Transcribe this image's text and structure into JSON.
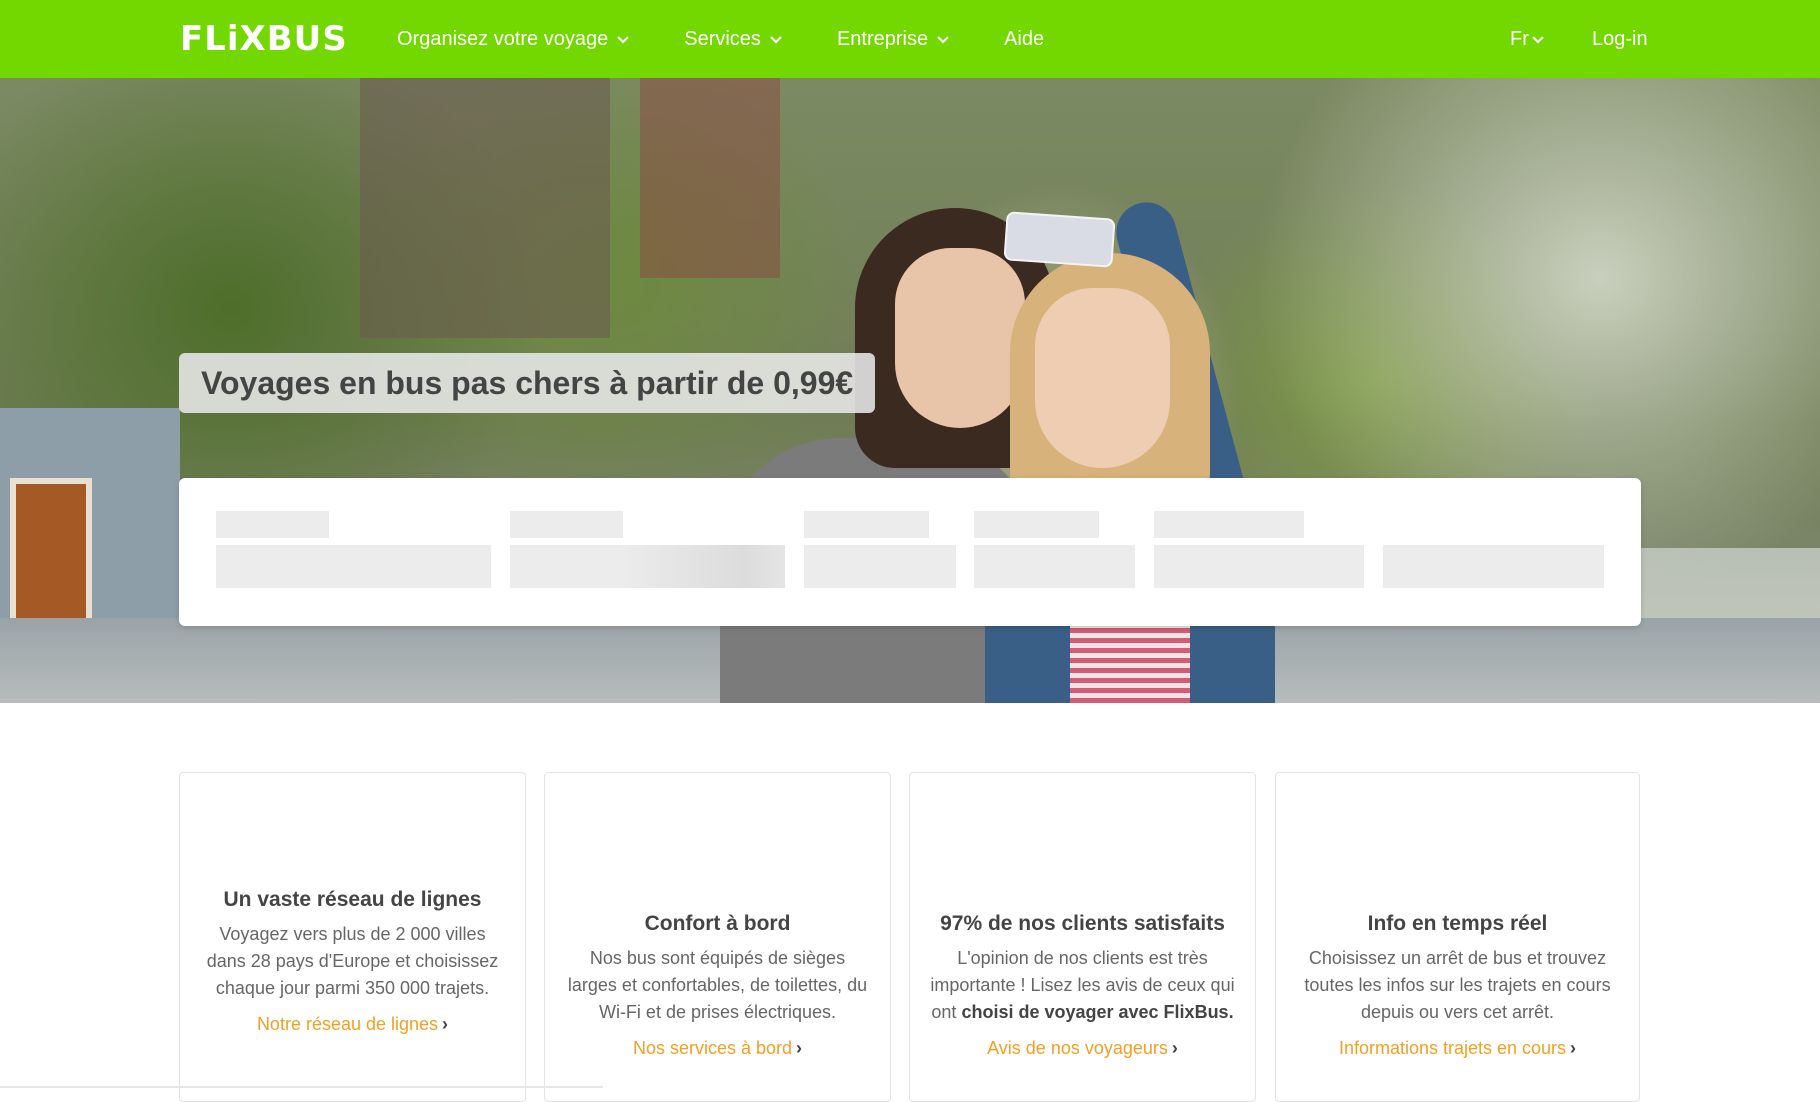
{
  "nav": {
    "logo": "FLiXBUS",
    "menu": [
      {
        "label": "Organisez votre voyage",
        "has_dropdown": true
      },
      {
        "label": "Services",
        "has_dropdown": true
      },
      {
        "label": "Entreprise",
        "has_dropdown": true
      },
      {
        "label": "Aide",
        "has_dropdown": false
      }
    ],
    "language": "Fr",
    "login": "Log-in"
  },
  "hero": {
    "title": "Voyages en bus pas chers à partir de 0,99€"
  },
  "features": [
    {
      "title": "Un vaste réseau de lignes",
      "description": "Voyagez vers plus de 2 000 villes dans 28 pays d'Europe et choisissez chaque jour parmi 350 000 trajets.",
      "link": "Notre réseau de lignes"
    },
    {
      "title": "Confort à bord",
      "description": "Nos bus sont équipés de sièges larges et confortables, de toilettes, du Wi-Fi et de prises électriques.",
      "link": "Nos services à bord"
    },
    {
      "title": "97% de nos clients satisfaits",
      "description_plain": "L'opinion de nos clients est très importante ! Lisez les avis de ceux qui ont",
      "description_bold": "choisi de voyager avec FlixBus.",
      "link": "Avis de nos voyageurs"
    },
    {
      "title": "Info en temps réel",
      "description": "Choisissez un arrêt de bus et trouvez toutes les infos sur les trajets en cours depuis ou vers cet arrêt.",
      "link": "Informations trajets en cours"
    }
  ],
  "colors": {
    "brand_green": "#73d700",
    "link_orange": "#f0a025",
    "text_dark": "#444444"
  },
  "icons": {
    "chevron": "chevron-down-icon",
    "link_arrow": "chevron-right-icon"
  }
}
